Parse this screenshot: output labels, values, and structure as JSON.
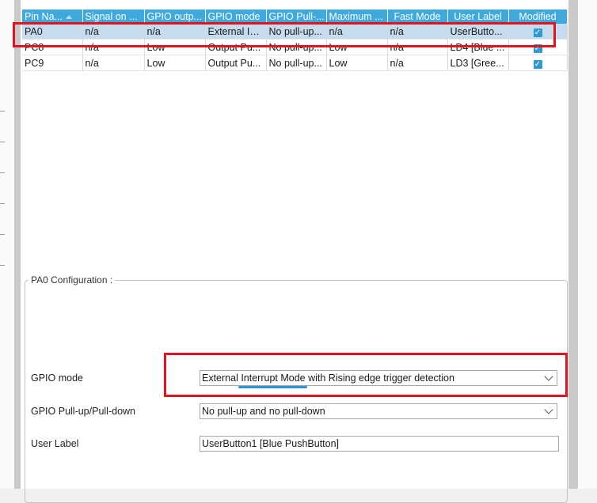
{
  "table": {
    "columns": [
      "Pin Na...",
      "Signal on ...",
      "GPIO outp...",
      "GPIO mode",
      "GPIO Pull-...",
      "Maximum ...",
      "Fast Mode",
      "User Label",
      "Modified"
    ],
    "rows": [
      [
        "PA0",
        "n/a",
        "n/a",
        "External In...",
        "No pull-up...",
        "n/a",
        "n/a",
        "UserButto...",
        "checked"
      ],
      [
        "PC8",
        "n/a",
        "Low",
        "Output Pu...",
        "No pull-up...",
        "Low",
        "n/a",
        "LD4 [Blue ...",
        "checked"
      ],
      [
        "PC9",
        "n/a",
        "Low",
        "Output Pu...",
        "No pull-up...",
        "Low",
        "n/a",
        "LD3 [Gree...",
        "checked"
      ]
    ],
    "selected_row": 0,
    "sorted_column": "Pin Na..."
  },
  "config": {
    "title": "PA0 Configuration :",
    "gpio_mode_label": "GPIO mode",
    "gpio_mode_value": "External Interrupt Mode with Rising edge trigger detection",
    "pull_label": "GPIO Pull-up/Pull-down",
    "pull_value": "No pull-up and no pull-down",
    "user_label_label": "User Label",
    "user_label_value": "UserButton1 [Blue PushButton]"
  },
  "icons": {
    "checkbox": "checkbox-checked-icon",
    "dropdown": "chevron-down-icon",
    "sort": "sort-ascending-icon"
  },
  "colors": {
    "header_bg": "#3fa9dc",
    "selected_row_bg": "#c7dbef",
    "highlight": "#e0141f",
    "accent": "#2f8fd8"
  }
}
